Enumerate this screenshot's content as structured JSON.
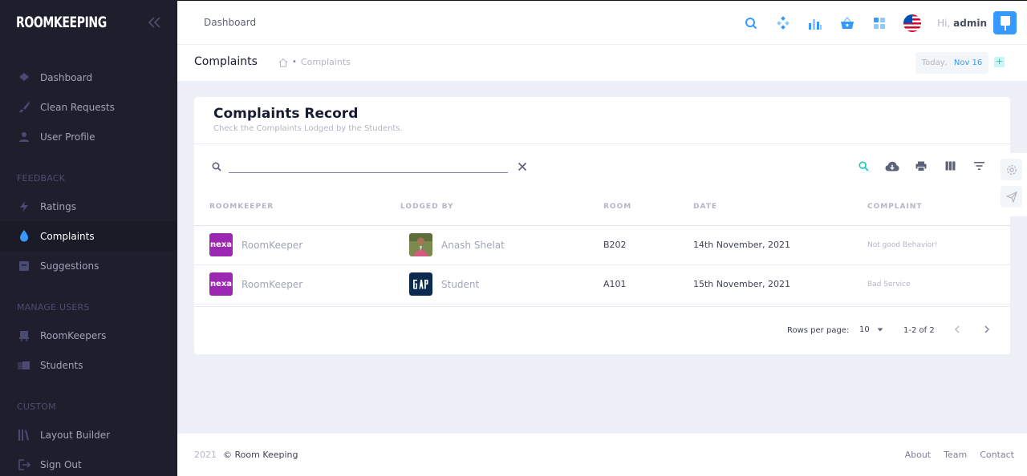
{
  "brand": {
    "logo": "ROOMKEEPING"
  },
  "sidebar": {
    "sections": [
      {
        "title": "",
        "items": [
          {
            "label": "Dashboard",
            "icon": "layers-icon"
          },
          {
            "label": "Clean Requests",
            "icon": "brush-icon"
          },
          {
            "label": "User Profile",
            "icon": "user-icon"
          }
        ]
      },
      {
        "title": "FEEDBACK",
        "items": [
          {
            "label": "Ratings",
            "icon": "lightning-icon"
          },
          {
            "label": "Complaints",
            "icon": "drop-icon",
            "active": true
          },
          {
            "label": "Suggestions",
            "icon": "note-icon"
          }
        ]
      },
      {
        "title": "MANAGE USERS",
        "items": [
          {
            "label": "RoomKeepers",
            "icon": "chair-icon"
          },
          {
            "label": "Students",
            "icon": "book-icon"
          }
        ]
      },
      {
        "title": "CUSTOM",
        "items": [
          {
            "label": "Layout Builder",
            "icon": "library-icon"
          },
          {
            "label": "Sign Out",
            "icon": "sign-out-icon"
          }
        ]
      }
    ]
  },
  "header": {
    "title": "Dashboard",
    "greeting": "Hi,",
    "username": "admin"
  },
  "subheader": {
    "title": "Complaints",
    "breadcrumb": "Complaints",
    "today_label": "Today,",
    "today_date": "Nov 16",
    "plus": "+"
  },
  "card": {
    "title": "Complaints Record",
    "subtitle": "Check the Complaints Lodged by the Students."
  },
  "search": {
    "value": "",
    "placeholder": ""
  },
  "table": {
    "columns": [
      "ROOMKEEPER",
      "LODGED BY",
      "ROOM",
      "DATE",
      "COMPLAINT"
    ],
    "rows": [
      {
        "roomkeeper_logo": "nexa",
        "roomkeeper": "RoomKeeper",
        "lodged_by": "Anash Shelat",
        "room": "B202",
        "date": "14th November, 2021",
        "complaint": "Not good Behavior!"
      },
      {
        "roomkeeper_logo": "nexa",
        "roomkeeper": "RoomKeeper",
        "lodged_by": "Student",
        "room": "A101",
        "date": "15th November, 2021",
        "complaint": "Bad Service"
      }
    ]
  },
  "pagination": {
    "rows_per_page_label": "Rows per page:",
    "rows_per_page": "10",
    "range": "1-2 of 2"
  },
  "footer": {
    "year": "2021",
    "name": "© Room Keeping",
    "links": [
      "About",
      "Team",
      "Contact"
    ]
  },
  "colors": {
    "primary": "#3699ff",
    "sidebar": "#1e1e2d",
    "nexa": "#9c27b0",
    "teal": "#1bc5bd"
  }
}
